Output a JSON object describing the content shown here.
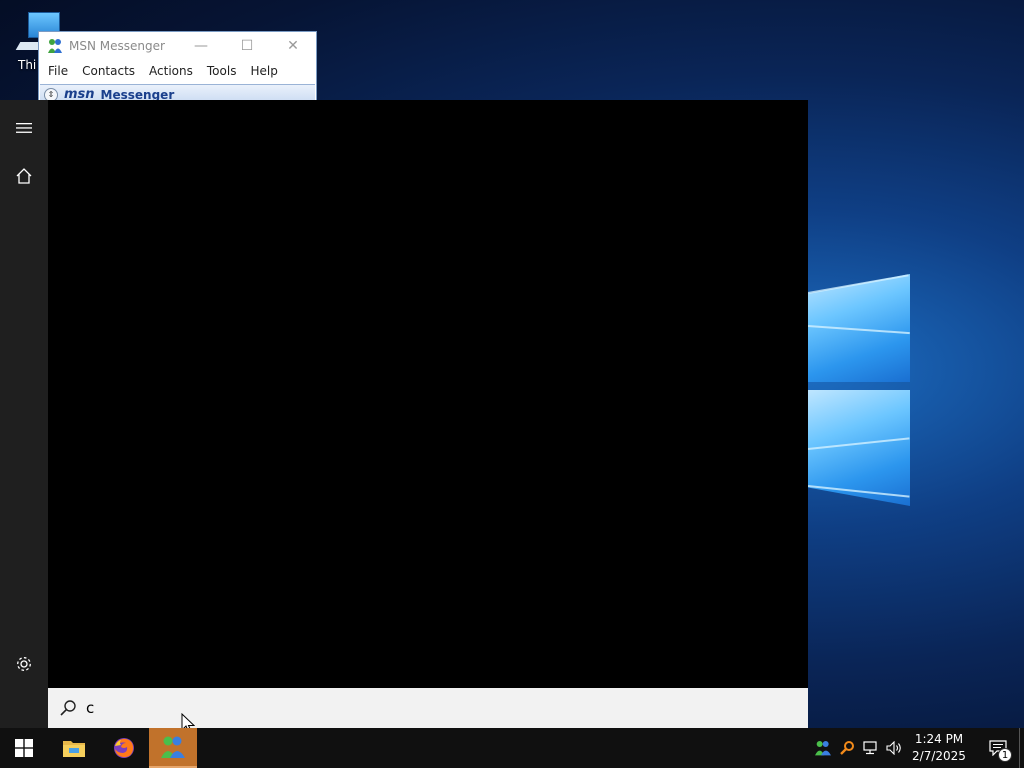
{
  "desktop": {
    "icons": [
      {
        "label": "Thi",
        "icon": "this-pc-icon"
      }
    ],
    "accent": "#0a2557"
  },
  "msn_window": {
    "title": "MSN Messenger",
    "controls": {
      "minimize": "—",
      "maximize": "☐",
      "close": "✕"
    },
    "menu": [
      "File",
      "Contacts",
      "Actions",
      "Tools",
      "Help"
    ],
    "banner": {
      "expand": "⇕",
      "brand": "msn",
      "product": "Messenger"
    }
  },
  "start_menu": {
    "rail": {
      "menu": "hamburger-icon",
      "home": "home-icon",
      "settings": "gear-icon"
    },
    "search": {
      "value": "c",
      "placeholder": ""
    }
  },
  "taskbar": {
    "apps": [
      {
        "name": "start",
        "icon": "windows-logo-icon"
      },
      {
        "name": "file-explorer",
        "icon": "folder-icon"
      },
      {
        "name": "firefox",
        "icon": "firefox-icon"
      },
      {
        "name": "msn-messenger",
        "icon": "msn-icon",
        "active": true
      }
    ],
    "tray": [
      "msn-icon",
      "search-icon",
      "network-icon",
      "volume-icon"
    ],
    "clock": {
      "time": "1:24 PM",
      "date": "2/7/2025"
    },
    "notifications": {
      "count": "1"
    },
    "accent": "#c1722b"
  }
}
